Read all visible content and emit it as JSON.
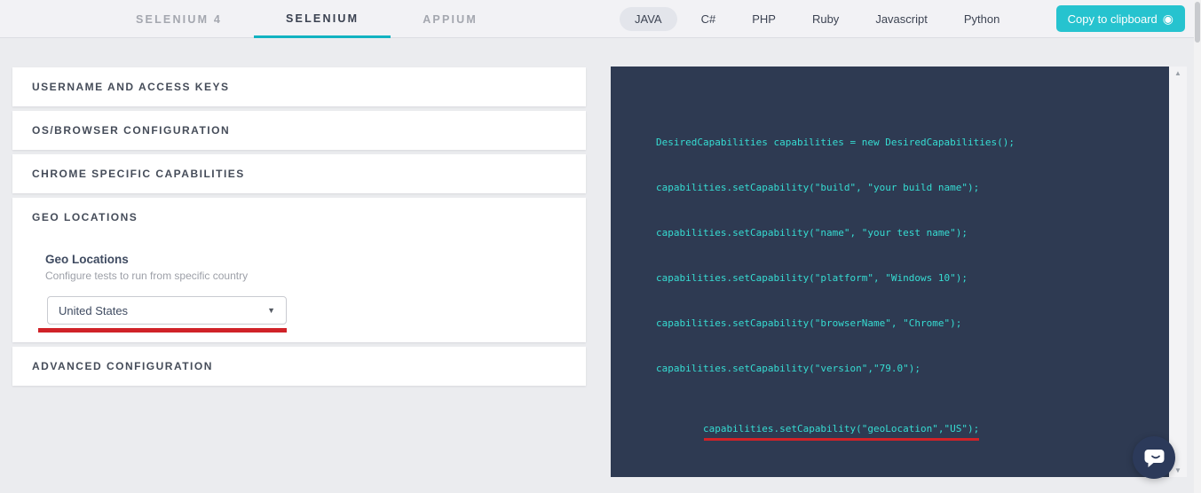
{
  "header": {
    "framework_tabs": [
      {
        "label": "SELENIUM 4",
        "active": false
      },
      {
        "label": "SELENIUM",
        "active": true
      },
      {
        "label": "APPIUM",
        "active": false
      }
    ],
    "language_tabs": [
      {
        "label": "JAVA",
        "active": true
      },
      {
        "label": "C#",
        "active": false
      },
      {
        "label": "PHP",
        "active": false
      },
      {
        "label": "Ruby",
        "active": false
      },
      {
        "label": "Javascript",
        "active": false
      },
      {
        "label": "Python",
        "active": false
      }
    ],
    "copy_button": {
      "label": "Copy to clipboard",
      "icon_glyph": "◉"
    }
  },
  "accordion": {
    "sections": [
      {
        "title": "USERNAME AND ACCESS KEYS",
        "expanded": false
      },
      {
        "title": "OS/BROWSER CONFIGURATION",
        "expanded": false
      },
      {
        "title": "CHROME SPECIFIC CAPABILITIES",
        "expanded": false
      },
      {
        "title": "GEO LOCATIONS",
        "expanded": true,
        "content": {
          "label": "Geo Locations",
          "description": "Configure tests to run from specific country",
          "dropdown_value": "United States",
          "dropdown_caret": "▼"
        }
      },
      {
        "title": "ADVANCED CONFIGURATION",
        "expanded": false
      }
    ]
  },
  "code_panel": {
    "language": "JAVA",
    "lines": [
      "DesiredCapabilities capabilities = new DesiredCapabilities();",
      "capabilities.setCapability(\"build\", \"your build name\");",
      "capabilities.setCapability(\"name\", \"your test name\");",
      "capabilities.setCapability(\"platform\", \"Windows 10\");",
      "capabilities.setCapability(\"browserName\", \"Chrome\");",
      "capabilities.setCapability(\"version\",\"79.0\");",
      "capabilities.setCapability(\"geoLocation\",\"US\");"
    ],
    "highlighted_line_index": 6
  },
  "scrollbar": {
    "up_glyph": "▲",
    "down_glyph": "▼"
  },
  "colors": {
    "page_bg": "#ebecef",
    "header_bg": "#f2f2f5",
    "card_bg": "#ffffff",
    "accent_teal": "#12b3c1",
    "button_teal": "#26c3cf",
    "annotation_red": "#d02228",
    "code_bg": "#2e3a52",
    "code_text": "#36dcd2",
    "chat_bubble_bg": "#2c3a5a"
  }
}
